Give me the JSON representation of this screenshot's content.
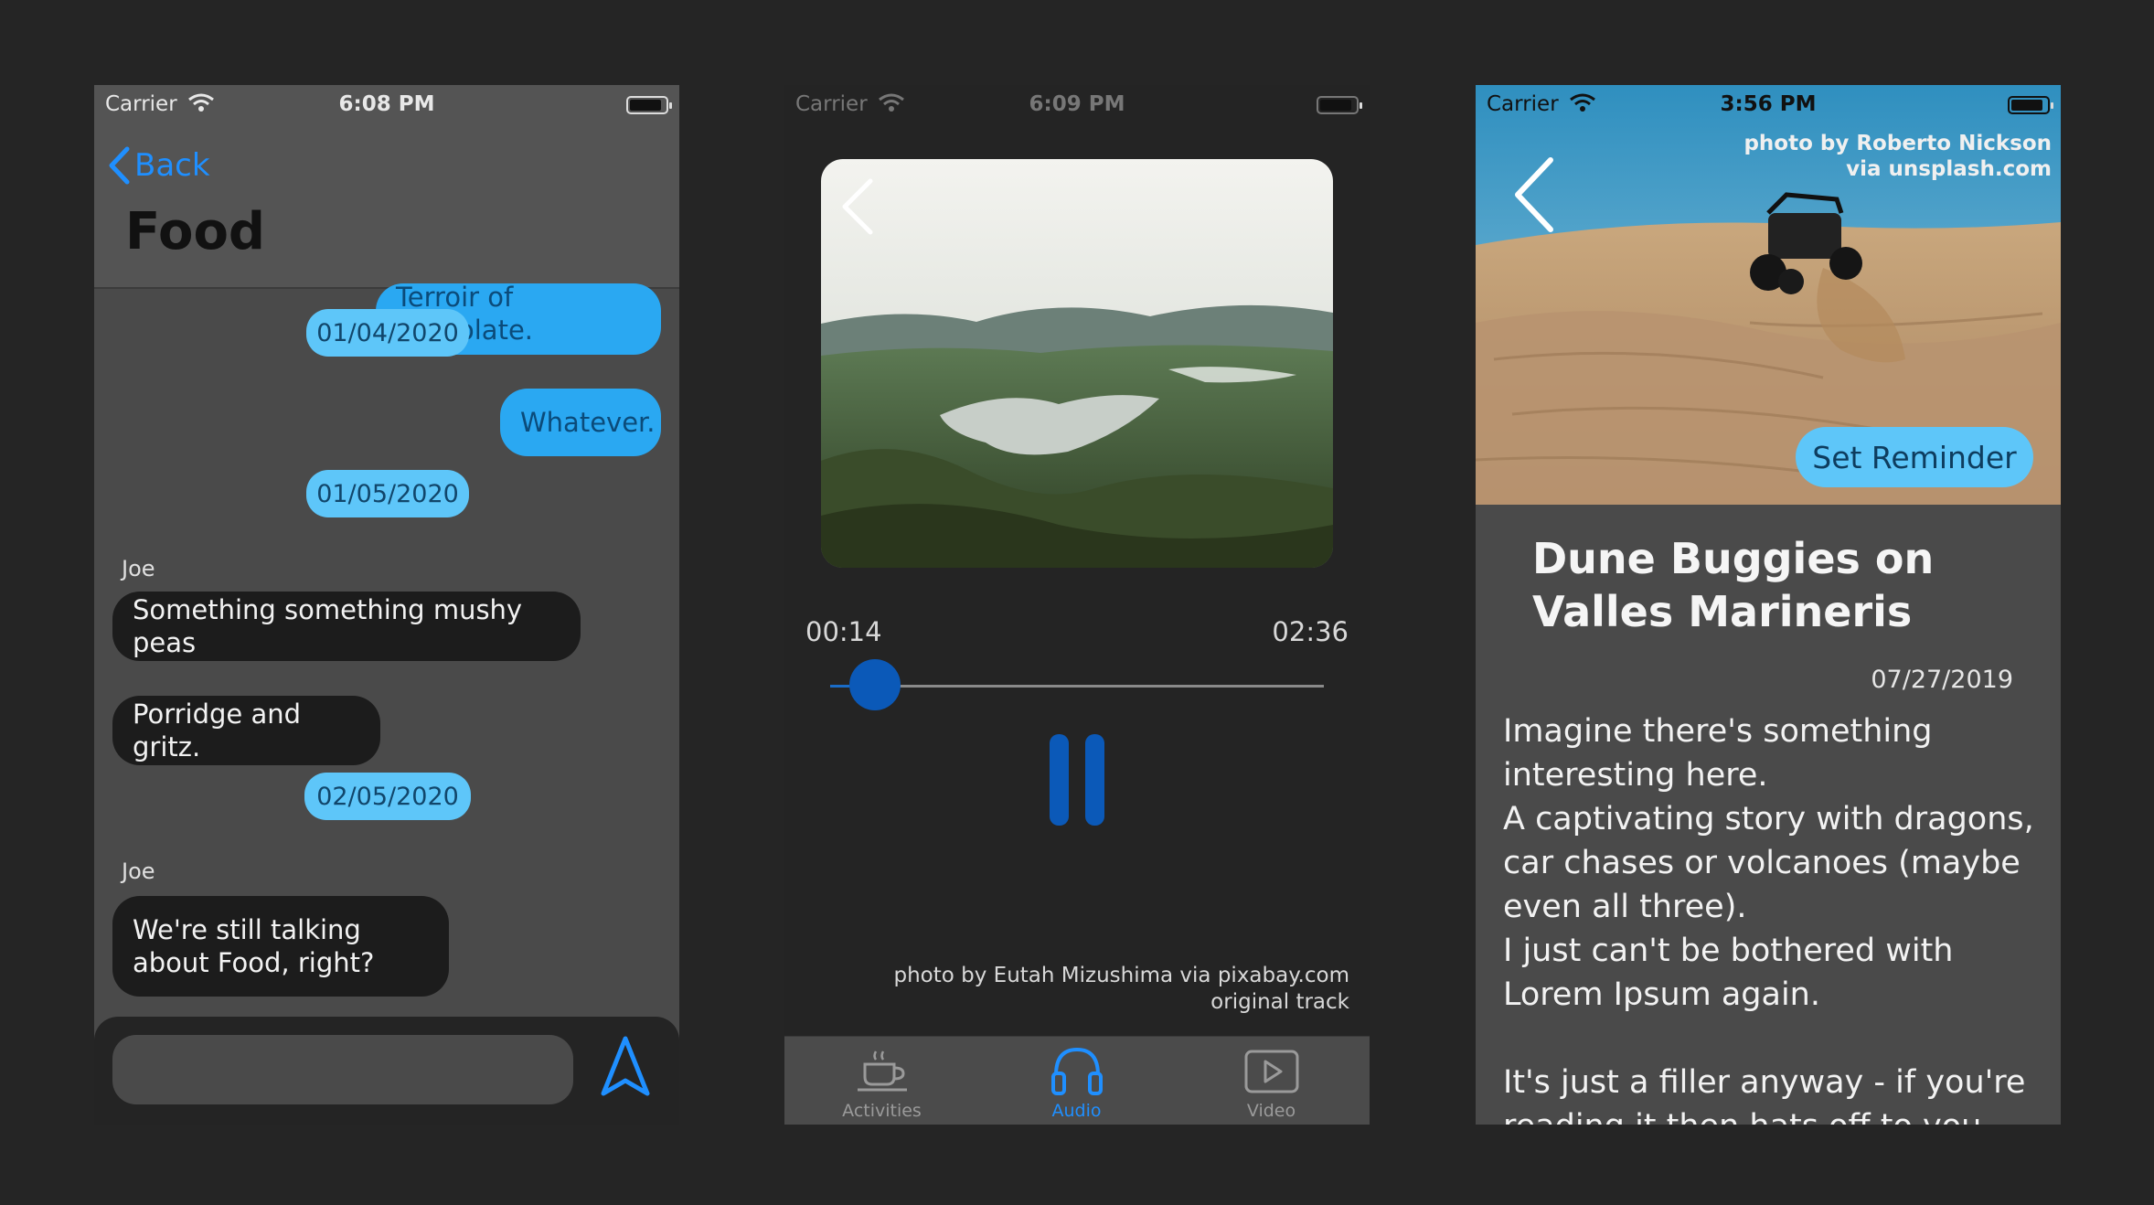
{
  "chat_screen": {
    "status": {
      "carrier": "Carrier",
      "time": "6:08 PM"
    },
    "nav": {
      "back_label": "Back",
      "title": "Food"
    },
    "messages": [
      {
        "kind": "out",
        "text": "Terroir of chocolate."
      },
      {
        "kind": "date",
        "text": "01/04/2020"
      },
      {
        "kind": "out",
        "text": "Whatever."
      },
      {
        "kind": "date",
        "text": "01/05/2020"
      },
      {
        "kind": "sender",
        "text": "Joe"
      },
      {
        "kind": "in",
        "text": "Something something mushy peas"
      },
      {
        "kind": "in",
        "text": "Porridge and gritz."
      },
      {
        "kind": "date",
        "text": "02/05/2020"
      },
      {
        "kind": "sender",
        "text": "Joe"
      },
      {
        "kind": "in",
        "text": "We're still talking about Food, right?"
      }
    ],
    "composer": {
      "placeholder": ""
    }
  },
  "audio_screen": {
    "status": {
      "carrier": "Carrier",
      "time": "6:09 PM"
    },
    "current_time": "00:14",
    "total_time": "02:36",
    "progress": 0.09,
    "credit_line1": "photo by Eutah Mizushima via pixabay.com",
    "credit_line2": "original track",
    "tabs": [
      {
        "label": "Activities",
        "icon": "coffee-cup-icon",
        "active": false
      },
      {
        "label": "Audio",
        "icon": "headphones-icon",
        "active": true
      },
      {
        "label": "Video",
        "icon": "play-icon",
        "active": false
      }
    ],
    "accent_color": "#0b59b8"
  },
  "article_screen": {
    "status": {
      "carrier": "Carrier",
      "time": "3:56 PM"
    },
    "photo_credit_line1": "photo by Roberto Nickson",
    "photo_credit_line2": "via unsplash.com",
    "reminder_label": "Set Reminder",
    "title": "Dune Buggies on Valles Marineris",
    "date": "07/27/2019",
    "body": "Imagine there's something interesting here.\nA captivating story with dragons, car chases or volcanoes (maybe even all three).\nI just can't be bothered with Lorem Ipsum again.\n\nIt's just a filler anyway - if you're reading it then hats off to you."
  }
}
